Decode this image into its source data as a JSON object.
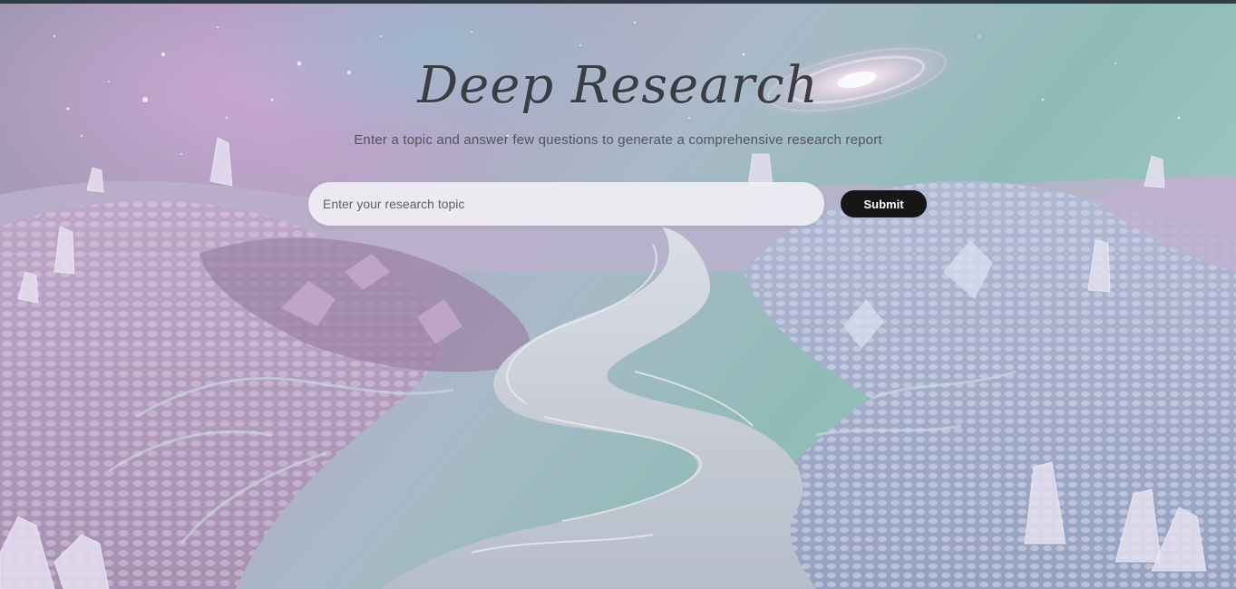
{
  "header": {
    "title": "Deep Research",
    "subtitle": "Enter a topic and answer few questions to generate a comprehensive research report"
  },
  "search": {
    "placeholder": "Enter your research topic",
    "value": "",
    "submit_label": "Submit"
  },
  "background": {
    "description_icon": "crystal-landscape-background",
    "colors": {
      "sky_pink": "#b89ac4",
      "sky_teal": "#7fb6ad",
      "river": "#c9ced8",
      "hills_purple": "#a88ab2",
      "hills_blue": "#8e9cc0",
      "crystal": "#e4dcf0"
    }
  },
  "accent": {
    "button_bg": "#161616",
    "button_text": "#ffffff",
    "title_color": "#3a3d44"
  }
}
